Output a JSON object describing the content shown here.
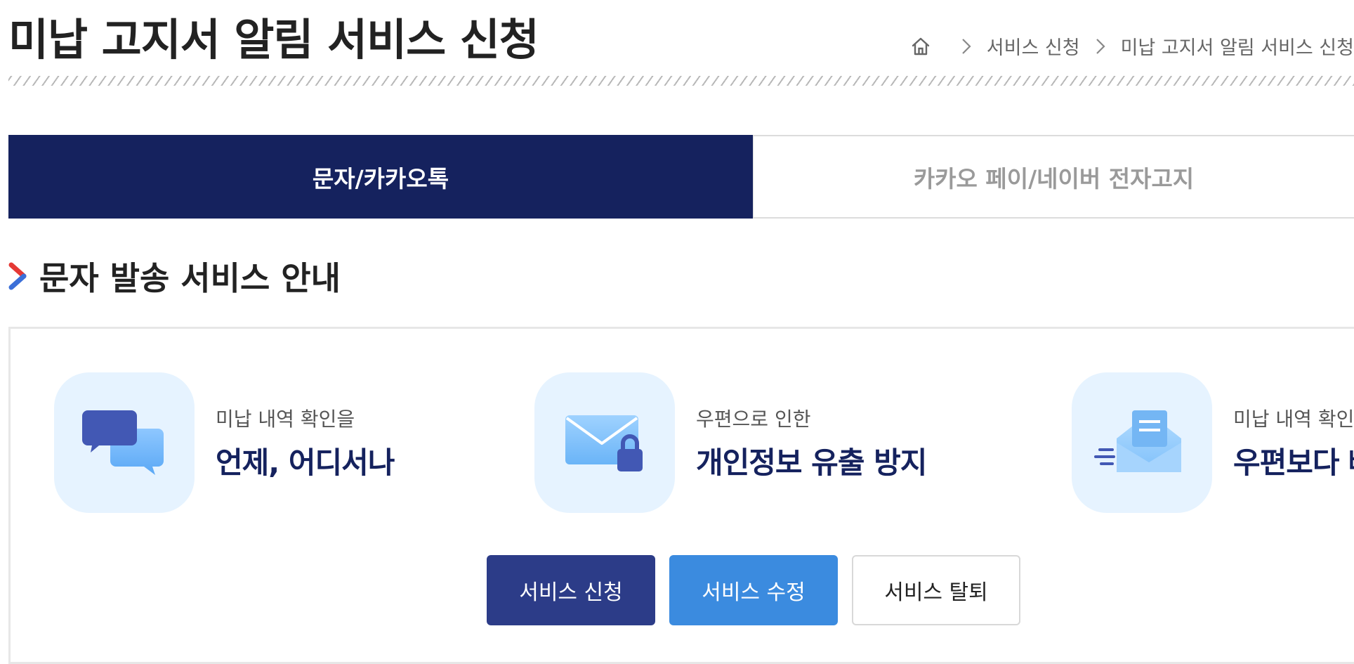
{
  "page": {
    "title": "미납 고지서 알림 서비스 신청"
  },
  "breadcrumb": {
    "home_icon": "home-icon",
    "items": [
      "서비스 신청",
      "미납 고지서 알림 서비스 신청"
    ]
  },
  "tabs": [
    {
      "label": "문자/카카오톡",
      "active": true
    },
    {
      "label": "카카오 페이/네이버 전자고지",
      "active": false
    }
  ],
  "section": {
    "title": "문자 발송 서비스 안내"
  },
  "features": [
    {
      "icon": "chat-bubbles-icon",
      "sub": "미납 내역 확인을",
      "main": "언제, 어디서나"
    },
    {
      "icon": "locked-envelope-icon",
      "sub": "우편으로 인한",
      "main": "개인정보 유출 방지"
    },
    {
      "icon": "fast-mail-icon",
      "sub": "미납 내역 확인",
      "main": "우편보다 빠"
    }
  ],
  "buttons": {
    "apply": "서비스 신청",
    "edit": "서비스 수정",
    "withdraw": "서비스 탈퇴"
  },
  "colors": {
    "primary_navy": "#15225e",
    "button_navy": "#2c3c88",
    "button_blue": "#3b8bdf",
    "icon_bg": "#e6f3ff"
  }
}
